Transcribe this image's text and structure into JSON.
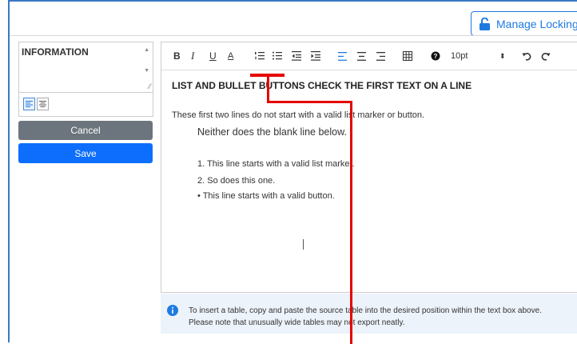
{
  "header": {
    "manage_locking_label": "Manage Locking"
  },
  "left_panel": {
    "field_text": "INFORMATION",
    "cancel_label": "Cancel",
    "save_label": "Save"
  },
  "toolbar": {
    "bold": "B",
    "italic": "I",
    "underline": "U",
    "font_color": "A",
    "font_size": "10pt"
  },
  "editor": {
    "heading": "LIST AND BULLET BUTTONS CHECK THE FIRST TEXT ON A LINE",
    "lines": [
      "These first two lines do not start with a valid list marker or button.",
      "Neither does the blank line below.",
      "1. This line starts with a valid list marker.",
      "2. So does this one.",
      "• This line starts with a valid button."
    ]
  },
  "note": {
    "line1": "To insert a table, copy and paste the source table into the desired position within the text box above.",
    "line2": "Please note that unusually wide tables may not export neatly."
  },
  "colors": {
    "primary": "#0d6efd",
    "secondary": "#6c757d",
    "annotation": "#e60000",
    "frame": "#3b78c4"
  }
}
